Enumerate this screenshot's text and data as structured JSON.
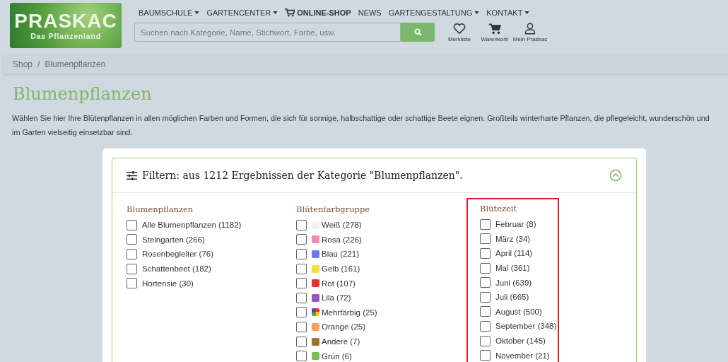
{
  "logo": {
    "name": "PRASKAC",
    "tagline": "Das Pflanzenland"
  },
  "nav": [
    {
      "label": "BAUMSCHULE",
      "dropdown": true,
      "cart": false
    },
    {
      "label": "GARTENCENTER",
      "dropdown": true,
      "cart": false
    },
    {
      "label": "ONLINE-SHOP",
      "dropdown": false,
      "cart": true
    },
    {
      "label": "NEWS",
      "dropdown": false,
      "cart": false
    },
    {
      "label": "GARTENGESTALTUNG",
      "dropdown": true,
      "cart": false
    },
    {
      "label": "KONTAKT",
      "dropdown": true,
      "cart": false
    }
  ],
  "search": {
    "placeholder": "Suchen nach Kategorie, Name, Stichwort, Farbe, usw."
  },
  "user_links": [
    {
      "kind": "heart",
      "label": "Merkliste"
    },
    {
      "kind": "cart",
      "label": "Warenkorb"
    },
    {
      "kind": "user",
      "label": "Mein Praskac"
    }
  ],
  "breadcrumb": [
    "Shop",
    "Blumenpflanzen"
  ],
  "breadcrumb_separator": "/",
  "page_title": "Blumenpflanzen",
  "description": "Wählen Sie hier Ihre Blütenpflanzen in allen möglichen Farben und Formen, die sich für sonnige, halbschattige oder schattige Beete eignen. Großteils winterharte Pflanzen, die pflegeleicht, wunderschön und im Garten vielseitig einsetzbar sind.",
  "filter": {
    "title": "Filtern: aus 1212 Ergebnissen der Kategorie \"Blumenpflanzen\".",
    "expanded": true,
    "groups": [
      {
        "title": "Blumenpflanzen",
        "highlighted": false,
        "options": [
          {
            "label": "Alle Blumenpflanzen (1182)",
            "checked": false
          },
          {
            "label": "Steingarten (266)",
            "checked": false
          },
          {
            "label": "Rosenbegleiter (76)",
            "checked": false
          },
          {
            "label": "Schattenbeet (182)",
            "checked": false
          },
          {
            "label": "Hortensie (30)",
            "checked": false
          }
        ]
      },
      {
        "title": "Blütenfarbgruppe",
        "highlighted": false,
        "options": [
          {
            "label": "Weiß (278)",
            "checked": false,
            "kind": "solid",
            "color": "#f2f2f2"
          },
          {
            "label": "Rosa (226)",
            "checked": false,
            "kind": "solid",
            "color": "#f08cb0"
          },
          {
            "label": "Blau (221)",
            "checked": false,
            "kind": "solid",
            "color": "#6f76f0"
          },
          {
            "label": "Gelb (161)",
            "checked": false,
            "kind": "solid",
            "color": "#f2e040"
          },
          {
            "label": "Rot (107)",
            "checked": false,
            "kind": "solid",
            "color": "#e83030"
          },
          {
            "label": "Lila (72)",
            "checked": false,
            "kind": "solid",
            "color": "#9a50c8"
          },
          {
            "label": "Mehrfärbig (25)",
            "checked": false,
            "kind": "multi"
          },
          {
            "label": "Orange (25)",
            "checked": false,
            "kind": "solid",
            "color": "#f8a060"
          },
          {
            "label": "Andere (7)",
            "checked": false,
            "kind": "solid",
            "color": "#a0742c"
          },
          {
            "label": "Grün (6)",
            "checked": false,
            "kind": "solid",
            "color": "#78c050"
          }
        ]
      },
      {
        "title": "Blütezeit",
        "highlighted": true,
        "options": [
          {
            "label": "Februar (8)",
            "checked": false
          },
          {
            "label": "März (34)",
            "checked": false
          },
          {
            "label": "April (114)",
            "checked": false
          },
          {
            "label": "Mai (361)",
            "checked": false
          },
          {
            "label": "Juni (639)",
            "checked": false
          },
          {
            "label": "Juli (665)",
            "checked": false
          },
          {
            "label": "August (500)",
            "checked": false
          },
          {
            "label": "September (348)",
            "checked": false
          },
          {
            "label": "Oktober (145)",
            "checked": false
          },
          {
            "label": "November (21)",
            "checked": false
          }
        ]
      }
    ]
  }
}
